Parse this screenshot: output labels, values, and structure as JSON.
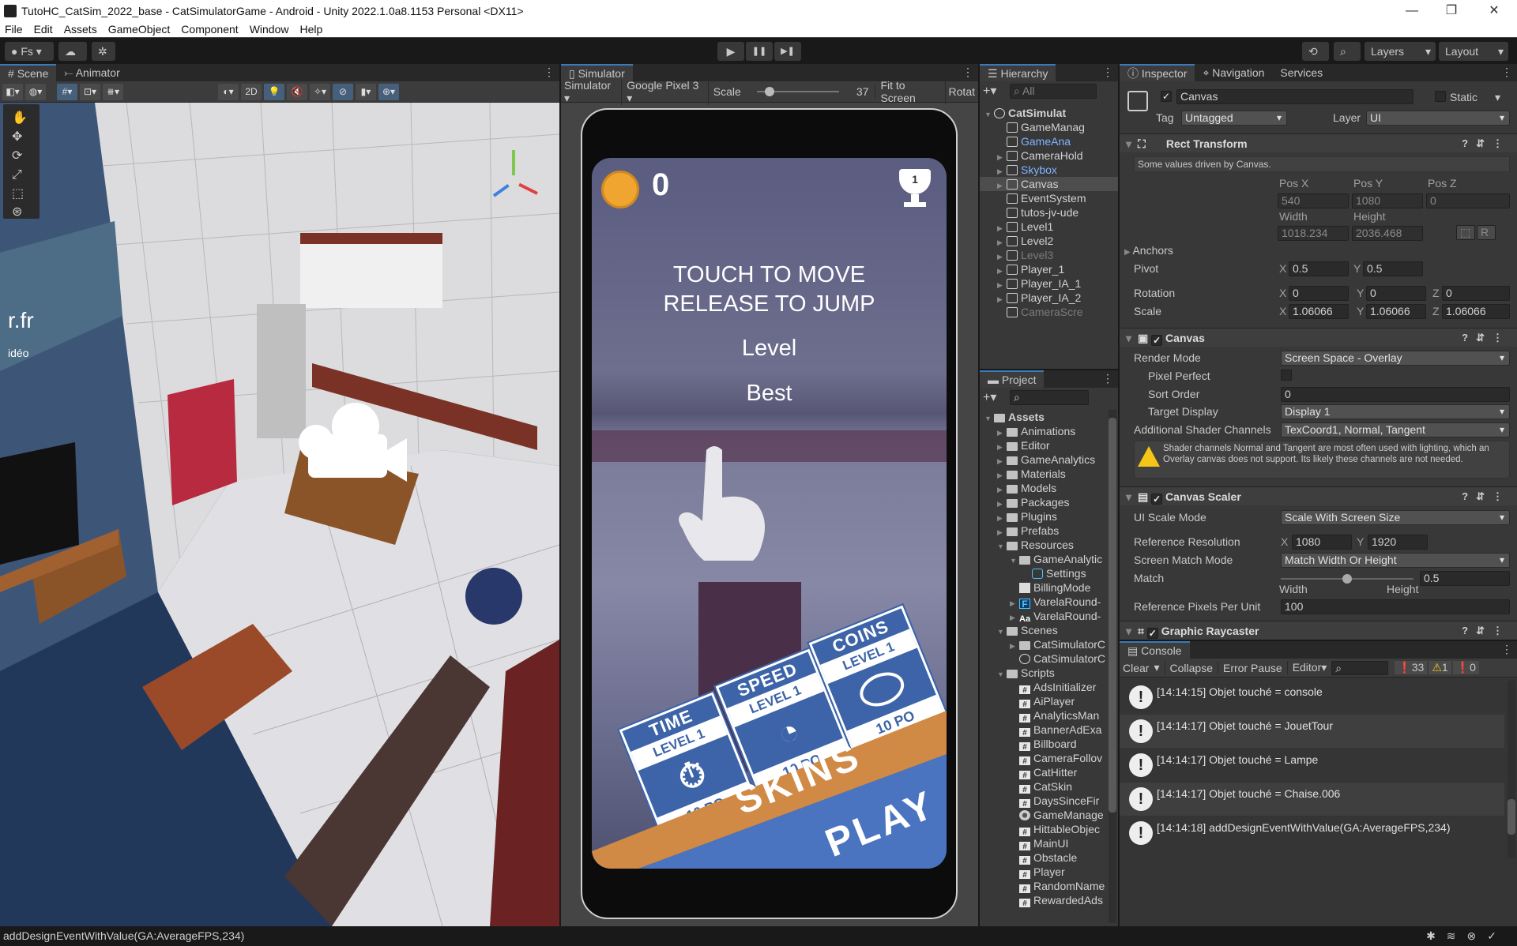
{
  "window": {
    "title": "TutoHC_CatSim_2022_base - CatSimulatorGame - Android - Unity 2022.1.0a8.1153 Personal <DX11>",
    "minimize": "—",
    "restore": "❐",
    "close": "✕"
  },
  "menu": [
    "File",
    "Edit",
    "Assets",
    "GameObject",
    "Component",
    "Window",
    "Help"
  ],
  "toolbar": {
    "account": "Fs",
    "play": "▶",
    "pause": "❚❚",
    "step": "▶❚",
    "layers": "Layers",
    "layout": "Layout"
  },
  "scene": {
    "tabs": [
      "Scene",
      "Animator"
    ],
    "btn_2d": "2D",
    "overlay_text": "r.fr",
    "overlay_sub": "idéo"
  },
  "simulator": {
    "tab": "Simulator",
    "mode": "Simulator",
    "device": "Google Pixel 3",
    "scale_label": "Scale",
    "scale_value": "37",
    "scale_fraction": 0.15,
    "fit": "Fit to Screen",
    "rotate": "Rotat"
  },
  "game": {
    "coins": "0",
    "trophy_rank": "1",
    "instruction1": "TOUCH TO MOVE",
    "instruction2": "RELEASE TO JUMP",
    "level": "Level",
    "best": "Best",
    "cards": [
      {
        "title": "TIME",
        "level": "LEVEL 1",
        "price": "10 PO",
        "icon": "stopwatch-icon"
      },
      {
        "title": "SPEED",
        "level": "LEVEL 1",
        "price": "10 PO",
        "icon": "speedometer-icon"
      },
      {
        "title": "COINS",
        "level": "LEVEL 1",
        "price": "10 PO",
        "icon": "coin-icon"
      }
    ],
    "skins": "SKINS",
    "play": "PLAY",
    "colors": {
      "skins": "#d08a45",
      "play": "#4a74bf",
      "card": "#3d64a8",
      "coin": "#f0a530"
    }
  },
  "hierarchy": {
    "tab": "Hierarchy",
    "search": "All",
    "items": [
      {
        "label": "CatSimulat",
        "depth": 0,
        "arrow": "open",
        "icon": "unity",
        "style": "root"
      },
      {
        "label": "GameManag",
        "depth": 1,
        "arrow": "",
        "icon": "cube"
      },
      {
        "label": "GameAna",
        "depth": 1,
        "arrow": "",
        "icon": "cube",
        "style": "blue"
      },
      {
        "label": "CameraHold",
        "depth": 1,
        "arrow": "closed",
        "icon": "cube"
      },
      {
        "label": "Skybox",
        "depth": 1,
        "arrow": "closed",
        "icon": "cube",
        "style": "blue"
      },
      {
        "label": "Canvas",
        "depth": 1,
        "arrow": "closed",
        "icon": "cube",
        "style": "sel"
      },
      {
        "label": "EventSystem",
        "depth": 1,
        "arrow": "",
        "icon": "cube"
      },
      {
        "label": "tutos-jv-ude",
        "depth": 1,
        "arrow": "",
        "icon": "cube"
      },
      {
        "label": "Level1",
        "depth": 1,
        "arrow": "closed",
        "icon": "cube"
      },
      {
        "label": "Level2",
        "depth": 1,
        "arrow": "closed",
        "icon": "cube"
      },
      {
        "label": "Level3",
        "depth": 1,
        "arrow": "closed",
        "icon": "cube",
        "style": "dis"
      },
      {
        "label": "Player_1",
        "depth": 1,
        "arrow": "closed",
        "icon": "cube"
      },
      {
        "label": "Player_IA_1",
        "depth": 1,
        "arrow": "closed",
        "icon": "cube"
      },
      {
        "label": "Player_IA_2",
        "depth": 1,
        "arrow": "closed",
        "icon": "cube"
      },
      {
        "label": "CameraScre",
        "depth": 1,
        "arrow": "",
        "icon": "cube",
        "style": "dis"
      }
    ]
  },
  "project": {
    "tab": "Project",
    "items": [
      {
        "label": "Assets",
        "depth": 0,
        "arrow": "open",
        "icon": "folder",
        "style": "bold"
      },
      {
        "label": "Animations",
        "depth": 1,
        "arrow": "closed",
        "icon": "folder"
      },
      {
        "label": "Editor",
        "depth": 1,
        "arrow": "closed",
        "icon": "folder"
      },
      {
        "label": "GameAnalytics",
        "depth": 1,
        "arrow": "closed",
        "icon": "folder"
      },
      {
        "label": "Materials",
        "depth": 1,
        "arrow": "closed",
        "icon": "folder"
      },
      {
        "label": "Models",
        "depth": 1,
        "arrow": "closed",
        "icon": "folder"
      },
      {
        "label": "Packages",
        "depth": 1,
        "arrow": "closed",
        "icon": "folder"
      },
      {
        "label": "Plugins",
        "depth": 1,
        "arrow": "closed",
        "icon": "folder"
      },
      {
        "label": "Prefabs",
        "depth": 1,
        "arrow": "closed",
        "icon": "folder"
      },
      {
        "label": "Resources",
        "depth": 1,
        "arrow": "open",
        "icon": "folder"
      },
      {
        "label": "GameAnalytic",
        "depth": 2,
        "arrow": "open",
        "icon": "folder"
      },
      {
        "label": "Settings",
        "depth": 3,
        "arrow": "",
        "icon": "settings"
      },
      {
        "label": "BillingMode",
        "depth": 2,
        "arrow": "",
        "icon": "doc"
      },
      {
        "label": "VarelaRound-",
        "depth": 2,
        "arrow": "closed",
        "icon": "font"
      },
      {
        "label": "VarelaRound-",
        "depth": 2,
        "arrow": "closed",
        "icon": "fonttxt"
      },
      {
        "label": "Scenes",
        "depth": 1,
        "arrow": "open",
        "icon": "folder"
      },
      {
        "label": "CatSimulatorC",
        "depth": 2,
        "arrow": "closed",
        "icon": "folder"
      },
      {
        "label": "CatSimulatorC",
        "depth": 2,
        "arrow": "",
        "icon": "unity"
      },
      {
        "label": "Scripts",
        "depth": 1,
        "arrow": "open",
        "icon": "folder"
      },
      {
        "label": "AdsInitializer",
        "depth": 2,
        "arrow": "",
        "icon": "script"
      },
      {
        "label": "AiPlayer",
        "depth": 2,
        "arrow": "",
        "icon": "script"
      },
      {
        "label": "AnalyticsMan",
        "depth": 2,
        "arrow": "",
        "icon": "script"
      },
      {
        "label": "BannerAdExa",
        "depth": 2,
        "arrow": "",
        "icon": "script"
      },
      {
        "label": "Billboard",
        "depth": 2,
        "arrow": "",
        "icon": "script"
      },
      {
        "label": "CameraFollov",
        "depth": 2,
        "arrow": "",
        "icon": "script"
      },
      {
        "label": "CatHitter",
        "depth": 2,
        "arrow": "",
        "icon": "script"
      },
      {
        "label": "CatSkin",
        "depth": 2,
        "arrow": "",
        "icon": "script"
      },
      {
        "label": "DaysSinceFir",
        "depth": 2,
        "arrow": "",
        "icon": "script"
      },
      {
        "label": "GameManage",
        "depth": 2,
        "arrow": "",
        "icon": "gear"
      },
      {
        "label": "HittableObjec",
        "depth": 2,
        "arrow": "",
        "icon": "script"
      },
      {
        "label": "MainUI",
        "depth": 2,
        "arrow": "",
        "icon": "script"
      },
      {
        "label": "Obstacle",
        "depth": 2,
        "arrow": "",
        "icon": "script"
      },
      {
        "label": "Player",
        "depth": 2,
        "arrow": "",
        "icon": "script"
      },
      {
        "label": "RandomName",
        "depth": 2,
        "arrow": "",
        "icon": "script"
      },
      {
        "label": "RewardedAds",
        "depth": 2,
        "arrow": "",
        "icon": "script"
      }
    ]
  },
  "inspector": {
    "tabs": [
      "Inspector",
      "Navigation",
      "Services"
    ],
    "object": {
      "name": "Canvas",
      "static": "Static",
      "tag_label": "Tag",
      "tag": "Untagged",
      "layer_label": "Layer",
      "layer": "UI"
    },
    "rect": {
      "title": "Rect Transform",
      "note": "Some values driven by Canvas.",
      "posx_l": "Pos X",
      "posy_l": "Pos Y",
      "posz_l": "Pos Z",
      "posx": "540",
      "posy": "1080",
      "posz": "0",
      "width_l": "Width",
      "height_l": "Height",
      "width": "1018.234",
      "height": "2036.468",
      "r": "R",
      "anchors": "Anchors",
      "pivot": "Pivot",
      "pivot_x": "0.5",
      "pivot_y": "0.5",
      "rotation": "Rotation",
      "rot_x": "0",
      "rot_y": "0",
      "rot_z": "0",
      "scale": "Scale",
      "scale_x": "1.06066",
      "scale_y": "1.06066",
      "scale_z": "1.06066",
      "x": "X",
      "y": "Y",
      "z": "Z"
    },
    "canvas": {
      "title": "Canvas",
      "render_mode_l": "Render Mode",
      "render_mode": "Screen Space - Overlay",
      "pixel_perfect_l": "Pixel Perfect",
      "sort_order_l": "Sort Order",
      "sort_order": "0",
      "target_display_l": "Target Display",
      "target_display": "Display 1",
      "shader_l": "Additional Shader Channels",
      "shader": "TexCoord1, Normal, Tangent",
      "warning": "Shader channels Normal and Tangent are most often used with lighting, which an Overlay canvas does not support. Its likely these channels are not needed."
    },
    "scaler": {
      "title": "Canvas Scaler",
      "ui_scale_l": "UI Scale Mode",
      "ui_scale": "Scale With Screen Size",
      "ref_res_l": "Reference Resolution",
      "ref_x": "1080",
      "ref_y": "1920",
      "match_mode_l": "Screen Match Mode",
      "match_mode": "Match Width Or Height",
      "match_l": "Match",
      "match": "0.5",
      "width_l": "Width",
      "height_l": "Height",
      "ppu_l": "Reference Pixels Per Unit",
      "ppu": "100"
    },
    "raycaster": {
      "title": "Graphic Raycaster"
    }
  },
  "console": {
    "tab": "Console",
    "clear": "Clear",
    "collapse": "Collapse",
    "error_pause": "Error Pause",
    "editor": "Editor",
    "log_count": "33",
    "warn_count": "1",
    "error_count": "0",
    "entries": [
      "[14:14:15] Objet touché = console",
      "[14:14:17] Objet touché = JouetTour",
      "[14:14:17] Objet touché = Lampe",
      "[14:14:17] Objet touché = Chaise.006",
      "[14:14:18] addDesignEventWithValue(GA:AverageFPS,234)"
    ]
  },
  "status": {
    "message": "addDesignEventWithValue(GA:AverageFPS,234)"
  }
}
